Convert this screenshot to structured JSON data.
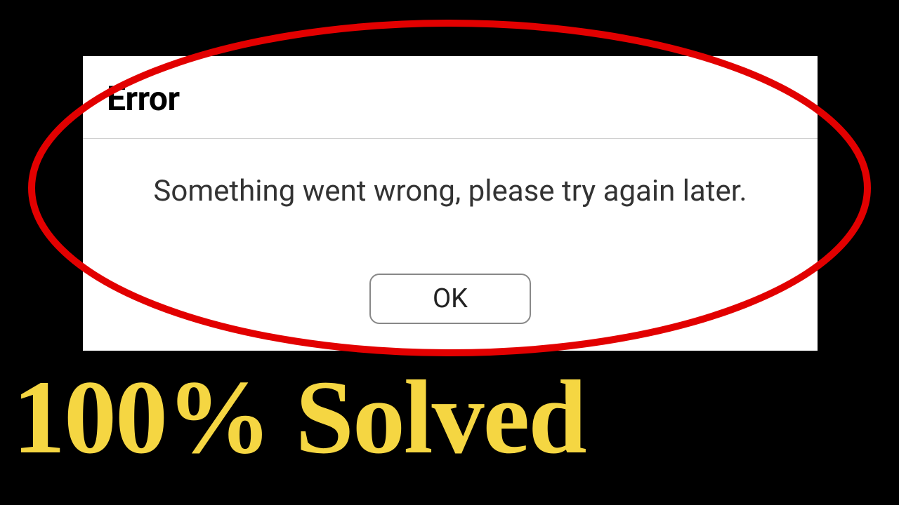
{
  "dialog": {
    "title": "Error",
    "message": "Something went wrong, please try again later.",
    "ok_label": "OK"
  },
  "caption": "100% Solved",
  "colors": {
    "highlight": "#e20000",
    "caption": "#f5d642"
  }
}
